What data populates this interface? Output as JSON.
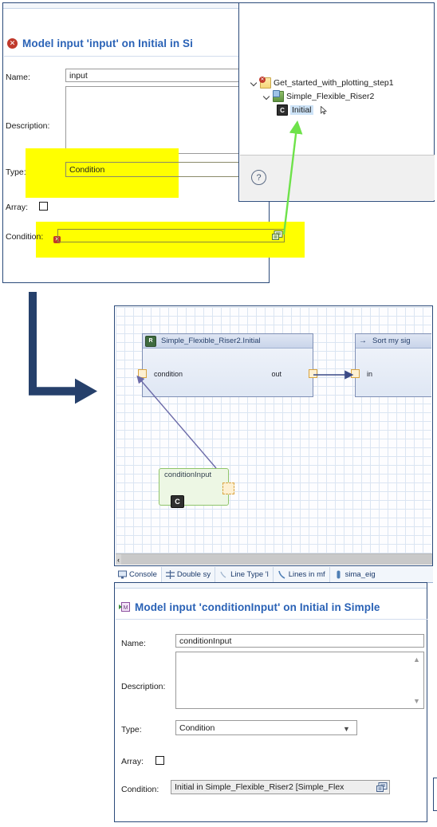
{
  "top_dialog": {
    "title": "Model input 'input' on Initial in Si",
    "status_icon": "error-icon",
    "fields": {
      "name_label": "Name:",
      "name_value": "input",
      "description_label": "Description:",
      "description_value": "",
      "type_label": "Type:",
      "type_value": "Condition",
      "array_label": "Array:",
      "array_checked": false,
      "condition_label": "Condition:",
      "condition_value": "",
      "condition_error": true,
      "condition_browse_icon": "select-reference-icon"
    }
  },
  "tree_panel": {
    "items": [
      {
        "label": "Get_started_with_plotting_step1",
        "icon": "project-folder-error-icon",
        "expanded": true,
        "depth": 0,
        "selected": false
      },
      {
        "label": "Simple_Flexible_Riser2",
        "icon": "model-green-icon",
        "expanded": true,
        "depth": 1,
        "selected": false
      },
      {
        "label": "Initial",
        "icon": "condition-c-icon",
        "expanded": false,
        "depth": 2,
        "selected": true
      }
    ],
    "footer": {
      "help_icon": "question-mark-icon"
    }
  },
  "annotations": {
    "green_arrow": {
      "name": "green-arrow-annotation",
      "from": "condition-field",
      "to": "tree-item-initial"
    },
    "navy_arrow": {
      "name": "navy-flow-arrow",
      "direction": "down-then-right"
    }
  },
  "diagram": {
    "nodes": [
      {
        "id": "initial-node",
        "title": "Simple_Flexible_Riser2.Initial",
        "badge": "R",
        "badge_color": "#3f6b3f",
        "in_port_label": "condition",
        "out_port_label": "out"
      },
      {
        "id": "sort-node",
        "title": "Sort my sig",
        "badge": "arrow-right-icon",
        "badge_color": "transparent",
        "in_port_label": "in",
        "out_port_label": ""
      }
    ],
    "condition_input_node": {
      "label": "conditionInput",
      "badge": "C",
      "port": "condition-output-port"
    },
    "scroll": {
      "left_arrow": "‹"
    }
  },
  "tabbar": {
    "tabs": [
      {
        "label": "Console",
        "icon": "console-icon"
      },
      {
        "label": "Double sy",
        "icon": "crosshair-icon"
      },
      {
        "label": "Line Type 'l",
        "icon": "line-icon"
      },
      {
        "label": "Lines in mf",
        "icon": "curve-icon"
      },
      {
        "label": "sima_eig",
        "icon": "capsule-icon"
      }
    ]
  },
  "bottom_dialog": {
    "title": "Model input 'conditionInput' on Initial in Simple",
    "status_icon": "model-input-icon",
    "fields": {
      "name_label": "Name:",
      "name_value": "conditionInput",
      "description_label": "Description:",
      "description_value": "",
      "type_label": "Type:",
      "type_value": "Condition",
      "array_label": "Array:",
      "array_checked": false,
      "condition_label": "Condition:",
      "condition_value": "Initial in Simple_Flexible_Riser2     [Simple_Flex",
      "condition_browse_icon": "select-reference-icon"
    }
  },
  "colors": {
    "highlight": "#ffff00",
    "title_blue": "#2a62b6",
    "dialog_border": "#2b4a7a",
    "navy_arrow": "#26406b",
    "green_arrow": "#6ee24a",
    "port_fill": "#fdf0d2",
    "port_border": "#d9a441"
  }
}
